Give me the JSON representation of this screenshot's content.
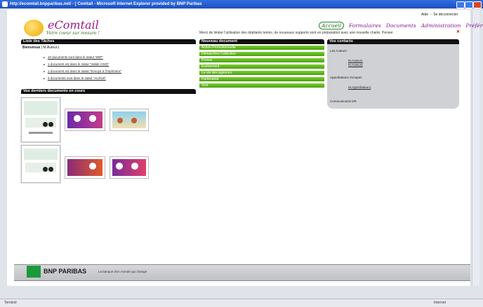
{
  "window": {
    "title": "http://ecomtail.bnpparibas.net/ - [ Comtail - Microsoft Internet Explorer provided by BNP Paribas"
  },
  "toplinks": {
    "help": "Aide",
    "logout": "Se déconnecter"
  },
  "logo": {
    "brand": "eComtail",
    "tagline": "Votre coeur sur mesure !"
  },
  "nav": [
    "Accueil",
    "Formulaires",
    "Documents",
    "Administration",
    "Préférences"
  ],
  "message": "Merci de limiter l'utilisation des dépliants tennis, de nouveaux supports sont en préparation avec une nouvelle charte. Penser",
  "tasks": {
    "header": "Liste des Tâches",
    "user_label": "Bienvenue",
    "user_value": "M.Auteur1",
    "items": [
      "10 documents sont dans le statut \"WIP\"",
      "1 document est dans le statut \"Valide AG/D\"",
      "1 document est dans le statut \"Envoyé à l'imprimeur\"",
      "3 documents sont dans le statut \"Archivé\""
    ]
  },
  "recent": {
    "header": "Vos derniers documents en cours"
  },
  "new_document": {
    "header": "Nouveau document",
    "items": [
      "Action Promotionnelle",
      "Démarches Collection",
      "Presse",
      "Evènement",
      "La vie des agences",
      "Partenariat",
      "Test"
    ]
  },
  "contacts": {
    "header": "Vos contacts",
    "authors_label": "Les Auteurs",
    "authors": [
      "M.Auteur1",
      "M.Auteur2"
    ],
    "approvers_label": "Approbateurs Groupes",
    "approvers": [
      "M.Approbateur1"
    ],
    "comm_label": "Communicants DR"
  },
  "footer": {
    "brand": "BNP PARIBAS",
    "slogan": "La banque d'un monde qui change"
  },
  "status": {
    "left": "Terminé",
    "right": "Internet"
  },
  "colors": {
    "green": "#5aae1c",
    "purple": "#8c1a8c",
    "header_black": "#111111"
  }
}
